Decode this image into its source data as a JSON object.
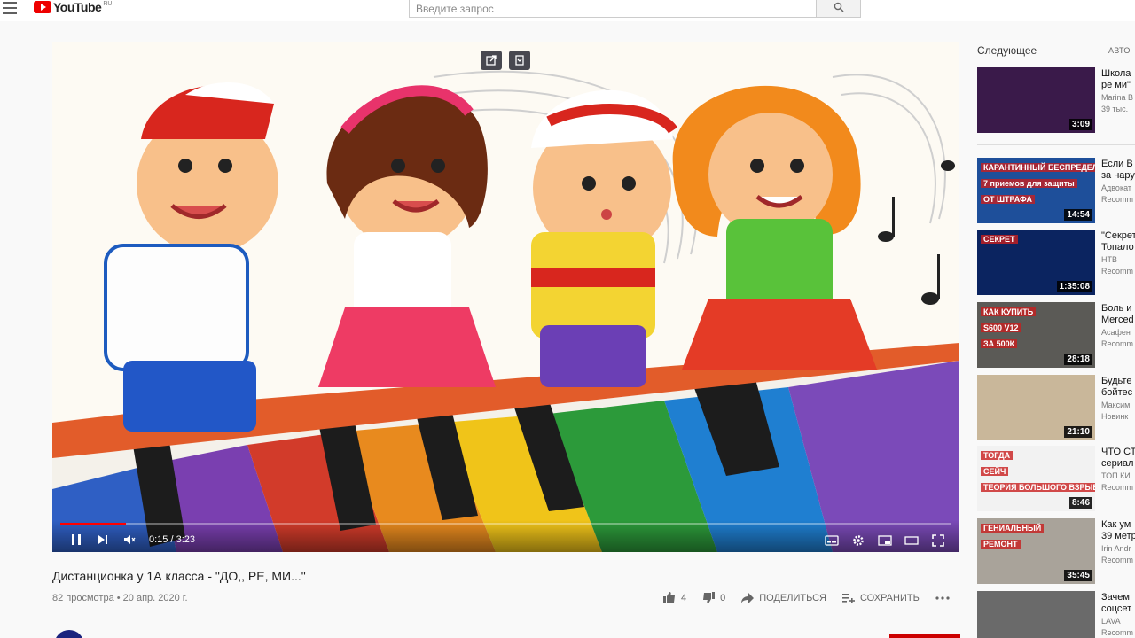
{
  "header": {
    "logo_text": "YouTube",
    "logo_region": "RU",
    "search_placeholder": "Введите запрос"
  },
  "player": {
    "time_display": "0:15 / 3:23",
    "progress_fraction": 0.074
  },
  "video": {
    "title": "Дистанционка у 1А класса - \"ДО,, РЕ, МИ...\"",
    "meta": "82 просмотра • 20 апр. 2020 г.",
    "likes": "4",
    "dislikes": "0",
    "share_label": "ПОДЕЛИТЬСЯ",
    "save_label": "СОХРАНИТЬ"
  },
  "sidebar": {
    "heading": "Следующее",
    "autoplay_label": "АВТО",
    "items": [
      {
        "title1": "Школа",
        "title2": "ре ми\"",
        "channel": "Marina B",
        "sub": "39 тыс.",
        "duration": "3:09",
        "thumb_color": "#3a1a4a"
      },
      {
        "title1": "Если В",
        "title2": "за нару",
        "channel": "Адвокат",
        "sub": "Recomm",
        "duration": "14:54",
        "thumb_color": "#1e4f9a",
        "caption1": "КАРАНТИННЫЙ БЕСПРЕДЕЛ",
        "caption2": "7 приемов для защиты",
        "caption3": "ОТ ШТРАФА"
      },
      {
        "title1": "\"Секрет",
        "title2": "Топало",
        "channel": "НТВ",
        "sub": "Recomm",
        "duration": "1:35:08",
        "thumb_color": "#0b2460",
        "caption1": "СЕКРЕТ"
      },
      {
        "title1": "Боль и",
        "title2": "Merced",
        "channel": "Асафен",
        "sub": "Recomm",
        "duration": "28:18",
        "thumb_color": "#5b5a56",
        "caption1": "КАК КУПИТЬ",
        "caption2": "S600 V12",
        "caption3": "ЗА 500К"
      },
      {
        "title1": "Будьте",
        "title2": "бойтес",
        "channel": "Максим",
        "sub": "Новинк",
        "duration": "21:10",
        "thumb_color": "#c9b79a"
      },
      {
        "title1": "ЧТО СТ",
        "title2": "сериал",
        "channel": "ТОП КИ",
        "sub": "Recomm",
        "duration": "8:46",
        "thumb_color": "#f2f2f2",
        "caption1": "ТОГДА",
        "caption2": "СЕЙЧ",
        "caption3": "ТЕОРИЯ БОЛЬШОГО ВЗРЫВА"
      },
      {
        "title1": "Как ум",
        "title2": "39 метр",
        "channel": "Irin Andr",
        "sub": "Recomm",
        "duration": "35:45",
        "thumb_color": "#a9a39a",
        "caption1": "ГЕНИАЛЬНЫЙ",
        "caption2": "РЕМОНТ"
      },
      {
        "title1": "Зачем",
        "title2": "соцсет",
        "channel": "LAVA",
        "sub": "Recomm",
        "duration": "",
        "thumb_color": "#6a6a6a"
      }
    ]
  },
  "colors": {
    "brand_red": "#ff0000",
    "accent_blue": "#1e4f9a"
  }
}
